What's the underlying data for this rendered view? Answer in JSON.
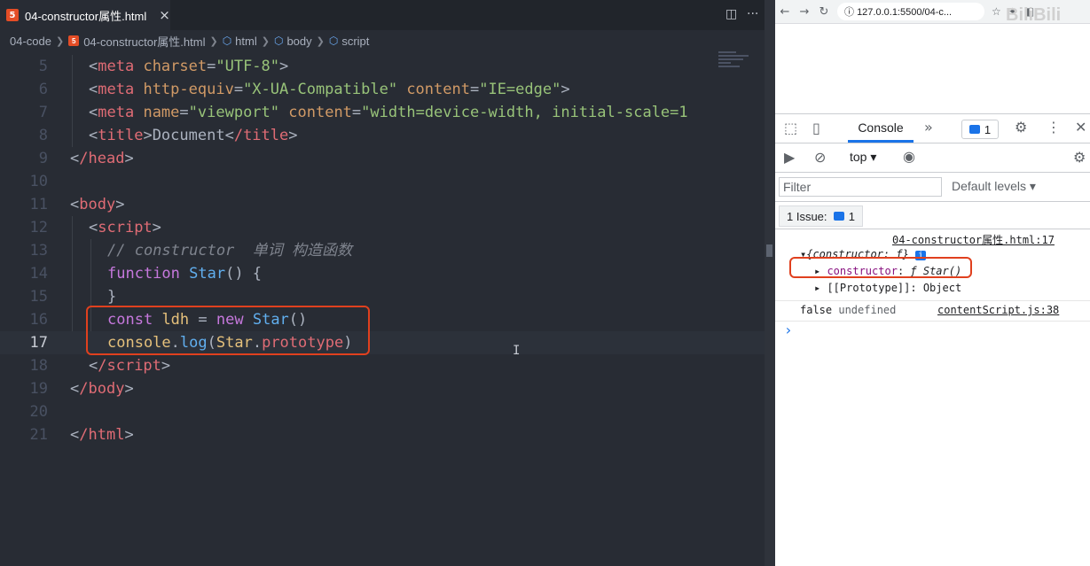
{
  "editor": {
    "tab_title": "04-constructor属性.html",
    "tab_close": "×",
    "tab_file_badge": "5",
    "split_icon": "◫",
    "more_icon": "···",
    "breadcrumb": {
      "folder": "04-code",
      "file": "04-constructor属性.html",
      "html": "html",
      "body": "body",
      "script": "script"
    },
    "lines": [
      {
        "no": "5"
      },
      {
        "no": "6"
      },
      {
        "no": "7"
      },
      {
        "no": "8"
      },
      {
        "no": "9"
      },
      {
        "no": "10"
      },
      {
        "no": "11"
      },
      {
        "no": "12"
      },
      {
        "no": "13"
      },
      {
        "no": "14"
      },
      {
        "no": "15"
      },
      {
        "no": "16"
      },
      {
        "no": "17"
      },
      {
        "no": "18"
      },
      {
        "no": "19"
      },
      {
        "no": "20"
      },
      {
        "no": "21"
      }
    ],
    "code": {
      "l5_tag": "meta",
      "l5_attr": "charset",
      "l5_str": "\"UTF-8\"",
      "l6_tag": "meta",
      "l6_attr1": "http-equiv",
      "l6_str1": "\"X-UA-Compatible\"",
      "l6_attr2": "content",
      "l6_str2": "\"IE=edge\"",
      "l7_tag": "meta",
      "l7_attr1": "name",
      "l7_str1": "\"viewport\"",
      "l7_attr2": "content",
      "l7_str2": "\"width=device-width, initial-scale=1",
      "l8_tag": "title",
      "l8_text": "Document",
      "l8_ctag": "/title",
      "l9_tag": "/head",
      "l11_tag": "body",
      "l12_tag": "script",
      "l13_comment": "// constructor  单词 构造函数",
      "l14_kw": "function",
      "l14_fn": "Star",
      "l14_rest": "() {",
      "l15_text": "}",
      "l16_kw": "const",
      "l16_var": "ldh",
      "l16_eq": " = ",
      "l16_new": "new",
      "l16_fn": "Star",
      "l16_rest": "()",
      "l17_obj": "console",
      "l17_dot": ".",
      "l17_fn": "log",
      "l17_paren": "(",
      "l17_cls": "Star",
      "l17_dot2": ".",
      "l17_prop": "prototype",
      "l17_close": ")",
      "l18_tag": "/script",
      "l19_tag": "/body",
      "l21_tag": "/html"
    }
  },
  "browser": {
    "url": "127.0.0.1:5500/04-c...",
    "back": "←",
    "forward": "→",
    "reload": "↻",
    "watermark": "BiliBili"
  },
  "devtools": {
    "console_tab": "Console",
    "more_tabs": "»",
    "issue_count": "1",
    "context": "top",
    "filter_placeholder": "Filter",
    "levels": "Default levels",
    "issues_label": "1 Issue:",
    "issues_count": "1",
    "log": {
      "src1": "04-constructor属性.html:17",
      "obj_summary": "{constructor: f}",
      "info_badge": "i",
      "ctor_key": "constructor",
      "ctor_colon": ":",
      "ctor_val": "ƒ Star()",
      "proto_key": "[[Prototype]]",
      "proto_val": "Object",
      "false_text": "false",
      "undef_text": "undefined",
      "src2": "contentScript.js:38",
      "prompt": "›"
    }
  },
  "colors": {
    "editor_bg": "#282c34",
    "highlight_box": "#e0401e",
    "accent": "#1a73e8"
  }
}
